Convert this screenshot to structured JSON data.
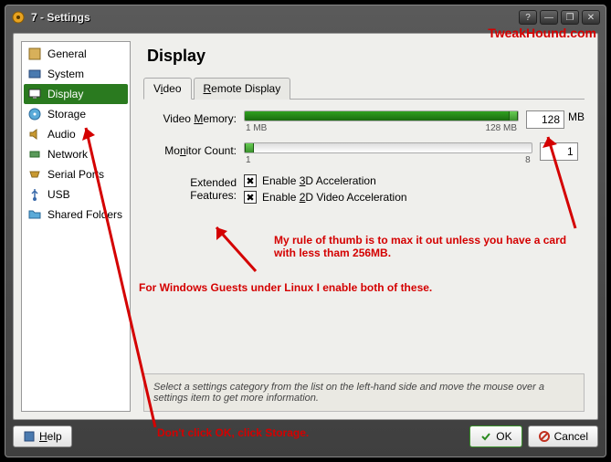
{
  "window": {
    "title": "7 - Settings"
  },
  "sidebar": {
    "items": [
      {
        "label": "General"
      },
      {
        "label": "System"
      },
      {
        "label": "Display"
      },
      {
        "label": "Storage"
      },
      {
        "label": "Audio"
      },
      {
        "label": "Network"
      },
      {
        "label": "Serial Ports"
      },
      {
        "label": "USB"
      },
      {
        "label": "Shared Folders"
      }
    ]
  },
  "page": {
    "title": "Display"
  },
  "tabs": [
    {
      "label_prefix": "V",
      "label_u": "i",
      "label_suffix": "deo"
    },
    {
      "label_prefix": "",
      "label_u": "R",
      "label_suffix": "emote Display"
    }
  ],
  "video_memory": {
    "label_prefix": "Video ",
    "label_u": "M",
    "label_suffix": "emory:",
    "value": "128",
    "unit": "MB",
    "min_label": "1 MB",
    "max_label": "128 MB"
  },
  "monitor_count": {
    "label_prefix": "Mo",
    "label_u": "n",
    "label_suffix": "itor Count:",
    "value": "1",
    "min_label": "1",
    "max_label": "8"
  },
  "features": {
    "label": "Extended Features:",
    "f3d_prefix": "Enable ",
    "f3d_u": "3",
    "f3d_suffix": "D Acceleration",
    "f2d_prefix": "Enable ",
    "f2d_u": "2",
    "f2d_suffix": "D Video Acceleration"
  },
  "info": "Select a settings category from the list on the left-hand side and move the mouse over a settings item to get more information.",
  "buttons": {
    "help_u": "H",
    "help_suffix": "elp",
    "ok": "OK",
    "cancel": "Cancel"
  },
  "annotations": {
    "watermark": "TweakHound.com",
    "max_rule": "My rule of thumb is to max it out unless you have a card with less tham 256MB.",
    "both": "For Windows Guests under Linux I enable both of these.",
    "storage": "Don't click OK, click Storage."
  },
  "colors": {
    "accent": "#2a7a1f",
    "annot": "#d40000"
  }
}
